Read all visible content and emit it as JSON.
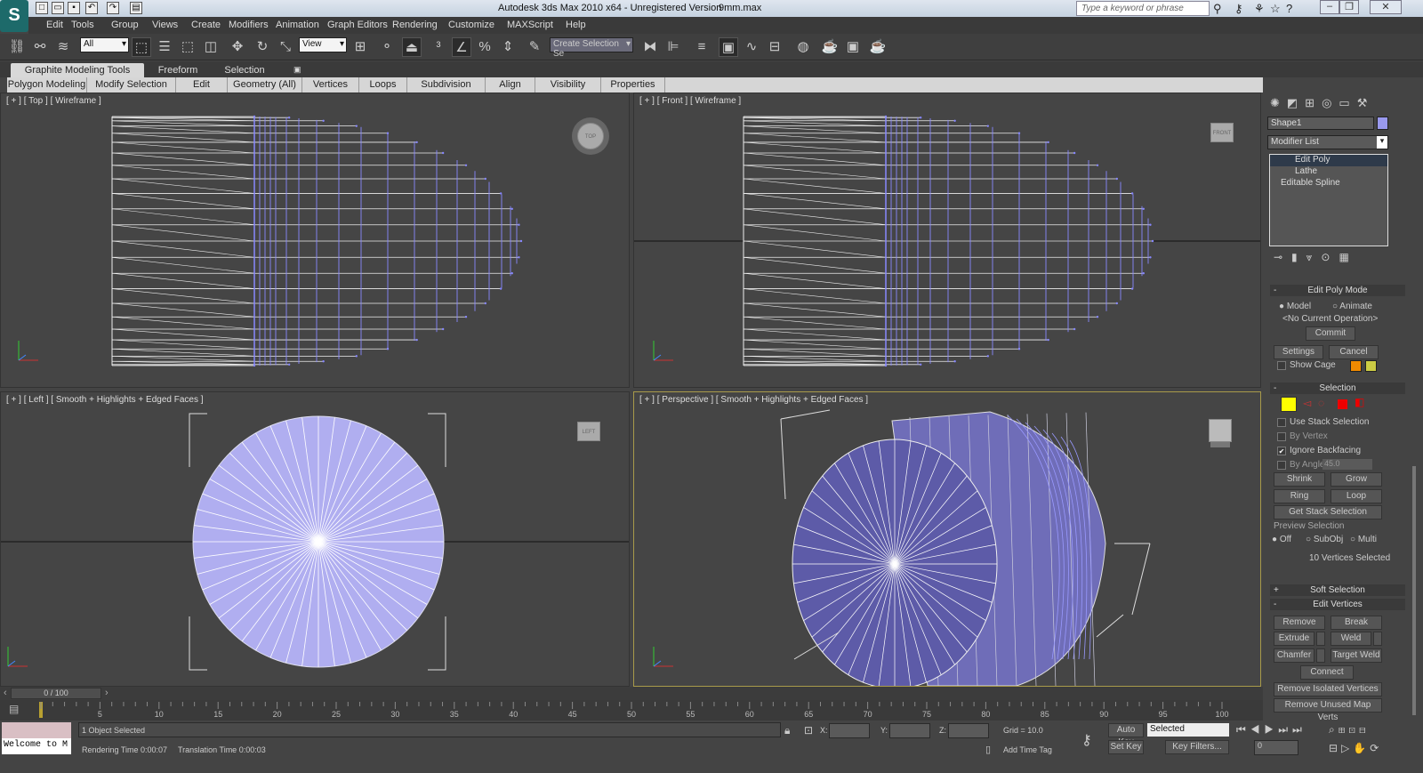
{
  "title_bar": {
    "app_title": "Autodesk 3ds Max  2010 x64  - Unregistered Version",
    "file_name": "9mm.max",
    "search_placeholder": "Type a keyword or phrase",
    "app_icon": "S"
  },
  "menu": [
    "Edit",
    "Tools",
    "Group",
    "Views",
    "Create",
    "Modifiers",
    "Animation",
    "Graph Editors",
    "Rendering",
    "Customize",
    "MAXScript",
    "Help"
  ],
  "toolbar": {
    "selection_filter": "All",
    "reference_coord": "View",
    "named_selection": "Create Selection Se",
    "snap_label": "3"
  },
  "graphite_tabs": [
    "Graphite Modeling Tools",
    "Freeform",
    "Selection"
  ],
  "ribbon": [
    "Polygon Modeling",
    "Modify Selection",
    "Edit",
    "Geometry (All)",
    "Vertices",
    "Loops",
    "Subdivision",
    "Align",
    "Visibility",
    "Properties"
  ],
  "viewports": {
    "top": {
      "label": "[ + ] [ Top ] [ Wireframe ]",
      "cube": "TOP"
    },
    "front": {
      "label": "[ + ] [ Front ] [ Wireframe ]",
      "cube": "FRONT"
    },
    "left": {
      "label": "[ + ] [ Left ] [ Smooth + Highlights + Edged Faces ]",
      "cube": "LEFT"
    },
    "perspective": {
      "label": "[ + ] [ Perspective ] [ Smooth + Highlights + Edged Faces ]"
    }
  },
  "command_panel": {
    "object_name": "Shape1",
    "object_color": "#9999ee",
    "modifier_list": "Modifier List",
    "stack": [
      "Edit Poly",
      "Lathe",
      "Editable Spline"
    ],
    "edit_poly_mode": {
      "title": "Edit Poly Mode",
      "model": "Model",
      "animate": "Animate",
      "operation": "<No Current Operation>",
      "commit": "Commit",
      "settings": "Settings",
      "cancel": "Cancel",
      "show_cage": "Show Cage"
    },
    "selection": {
      "title": "Selection",
      "use_stack": "Use Stack Selection",
      "by_vertex": "By Vertex",
      "ignore_backfacing": "Ignore Backfacing",
      "by_angle": "By Angle:",
      "angle_value": "45.0",
      "shrink": "Shrink",
      "grow": "Grow",
      "ring": "Ring",
      "loop": "Loop",
      "get_stack": "Get Stack Selection",
      "preview": "Preview Selection",
      "off": "Off",
      "subobj": "SubObj",
      "multi": "Multi",
      "count": "10 Vertices Selected"
    },
    "soft_selection": "Soft Selection",
    "edit_vertices": {
      "title": "Edit Vertices",
      "remove": "Remove",
      "break": "Break",
      "extrude": "Extrude",
      "weld": "Weld",
      "chamfer": "Chamfer",
      "target_weld": "Target Weld",
      "connect": "Connect",
      "remove_isolated": "Remove Isolated Vertices",
      "remove_unused": "Remove Unused Map Verts"
    }
  },
  "timeline": {
    "frame": "0 / 100",
    "ticks": [
      "5",
      "10",
      "15",
      "20",
      "25",
      "30",
      "35",
      "40",
      "45",
      "50",
      "55",
      "60",
      "65",
      "70",
      "75",
      "80",
      "85",
      "90",
      "95",
      "100"
    ]
  },
  "status": {
    "welcome": "Welcome to M",
    "selected": "1 Object Selected",
    "render_time": "Rendering Time  0:00:07",
    "translation_time": "Translation Time  0:00:03",
    "x_label": "X:",
    "y_label": "Y:",
    "z_label": "Z:",
    "grid": "Grid = 10.0",
    "add_time_tag": "Add Time Tag",
    "auto_key": "Auto Key",
    "set_key": "Set Key",
    "key_mode": "Selected",
    "key_filters": "Key Filters...",
    "current_frame": "0"
  }
}
